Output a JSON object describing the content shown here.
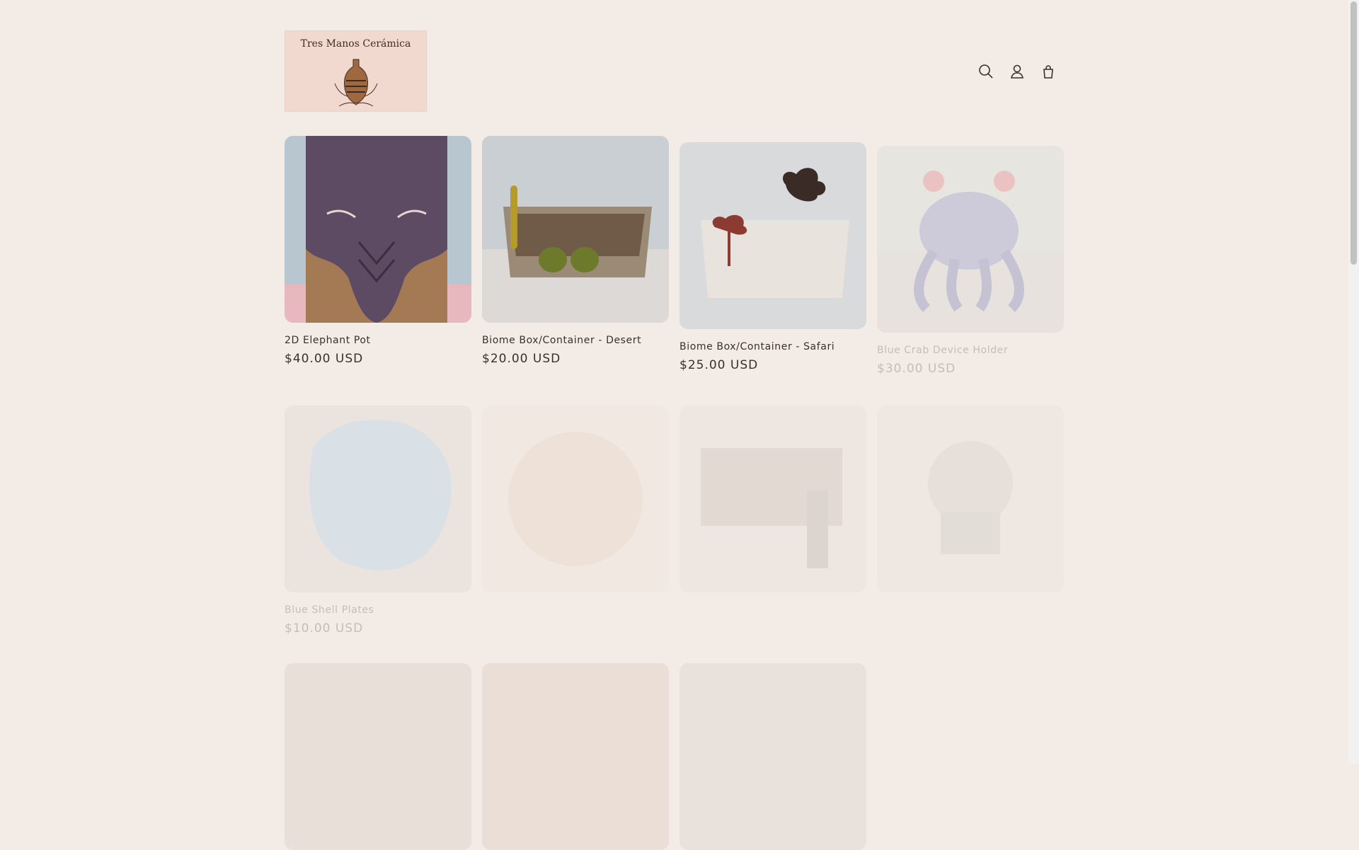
{
  "store": {
    "logo_text": "Tres Manos Cerámica"
  },
  "header": {
    "icons": [
      {
        "name": "search-icon",
        "label": "Search"
      },
      {
        "name": "account-icon",
        "label": "Log in"
      },
      {
        "name": "cart-icon",
        "label": "Cart"
      }
    ]
  },
  "products": [
    {
      "title": "2D Elephant Pot",
      "price": "$40.00 USD"
    },
    {
      "title": "Biome Box/Container - Desert",
      "price": "$20.00 USD"
    },
    {
      "title": "Biome Box/Container - Safari",
      "price": "$25.00 USD"
    },
    {
      "title": "Blue Crab Device Holder",
      "price": "$30.00 USD"
    },
    {
      "title": "Blue Shell Plates",
      "price": "$10.00 USD"
    }
  ],
  "colors": {
    "background": "#f3ece6",
    "text": "#3a2f2a",
    "logo_bg": "#f2d9cf"
  }
}
